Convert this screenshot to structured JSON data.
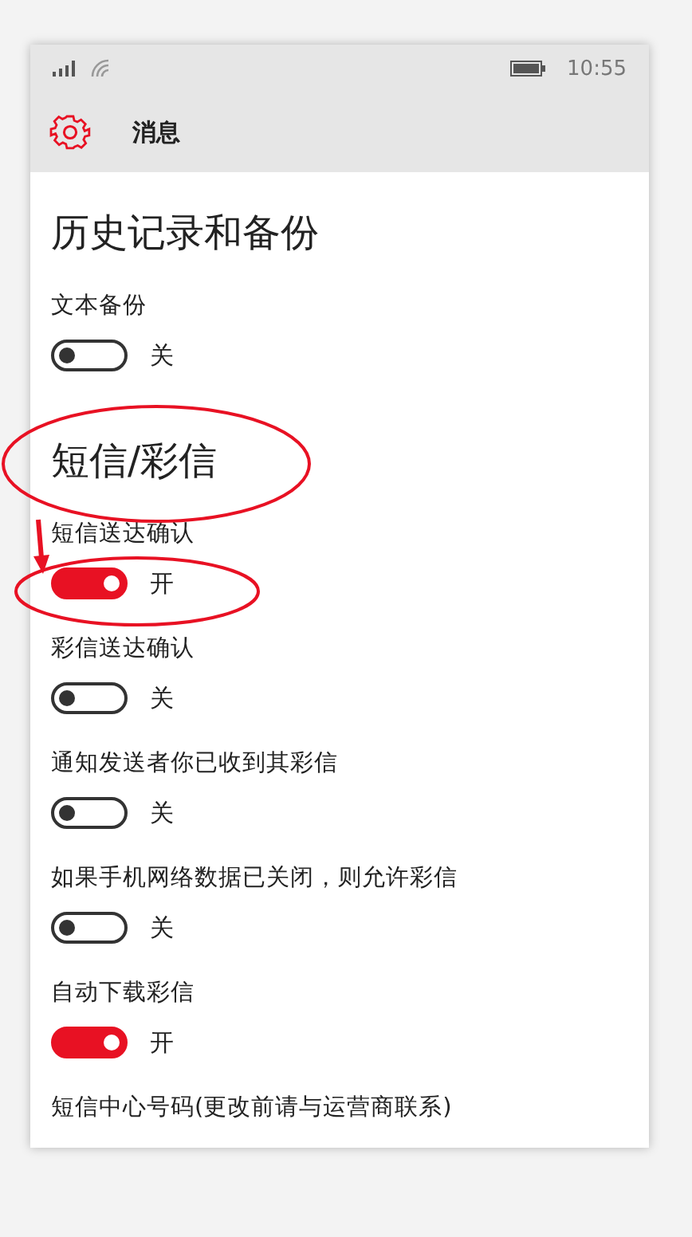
{
  "status_bar": {
    "time": "10:55"
  },
  "header": {
    "title": "消息"
  },
  "sections": [
    {
      "title": "历史记录和备份",
      "items": [
        {
          "kind": "toggle",
          "label": "文本备份",
          "on": false,
          "state_label": "关"
        }
      ]
    },
    {
      "title": "短信/彩信",
      "items": [
        {
          "kind": "toggle",
          "label": "短信送达确认",
          "on": true,
          "state_label": "开"
        },
        {
          "kind": "toggle",
          "label": "彩信送达确认",
          "on": false,
          "state_label": "关"
        },
        {
          "kind": "toggle",
          "label": "通知发送者你已收到其彩信",
          "on": false,
          "state_label": "关"
        },
        {
          "kind": "toggle",
          "label": "如果手机网络数据已关闭，则允许彩信",
          "on": false,
          "state_label": "关"
        },
        {
          "kind": "toggle",
          "label": "自动下载彩信",
          "on": true,
          "state_label": "开"
        },
        {
          "kind": "text",
          "label": "短信中心号码(更改前请与运营商联系)"
        }
      ]
    }
  ]
}
